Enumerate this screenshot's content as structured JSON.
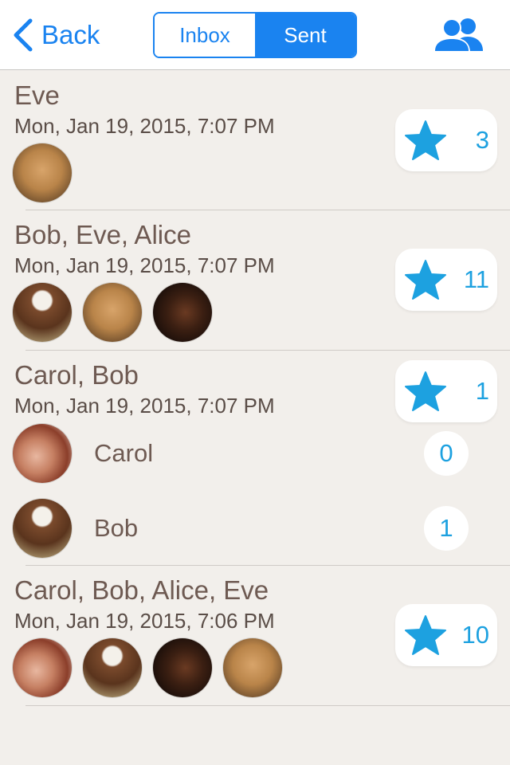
{
  "nav": {
    "back_label": "Back",
    "tabs": [
      {
        "label": "Inbox",
        "selected": false
      },
      {
        "label": "Sent",
        "selected": true
      }
    ],
    "contacts_icon": "contacts-icon"
  },
  "colors": {
    "accent": "#1a83f0",
    "count": "#1da1e0",
    "background": "#f2efeb",
    "name": "#6e5a52"
  },
  "threads": [
    {
      "names": "Eve",
      "date": "Mon, Jan 19, 2015, 7:07 PM",
      "stars": "3",
      "avatars": [
        "Eve"
      ]
    },
    {
      "names": "Bob, Eve, Alice",
      "date": "Mon, Jan 19, 2015, 7:07 PM",
      "stars": "11",
      "avatars": [
        "Bob",
        "Eve",
        "Alice"
      ]
    },
    {
      "names": "Carol, Bob",
      "date": "Mon, Jan 19, 2015, 7:07 PM",
      "stars": "1",
      "recipients": [
        {
          "name": "Carol",
          "count": "0"
        },
        {
          "name": "Bob",
          "count": "1"
        }
      ]
    },
    {
      "names": "Carol, Bob, Alice, Eve",
      "date": "Mon, Jan 19, 2015, 7:06 PM",
      "stars": "10",
      "avatars": [
        "Carol",
        "Bob",
        "Alice",
        "Eve"
      ]
    }
  ]
}
